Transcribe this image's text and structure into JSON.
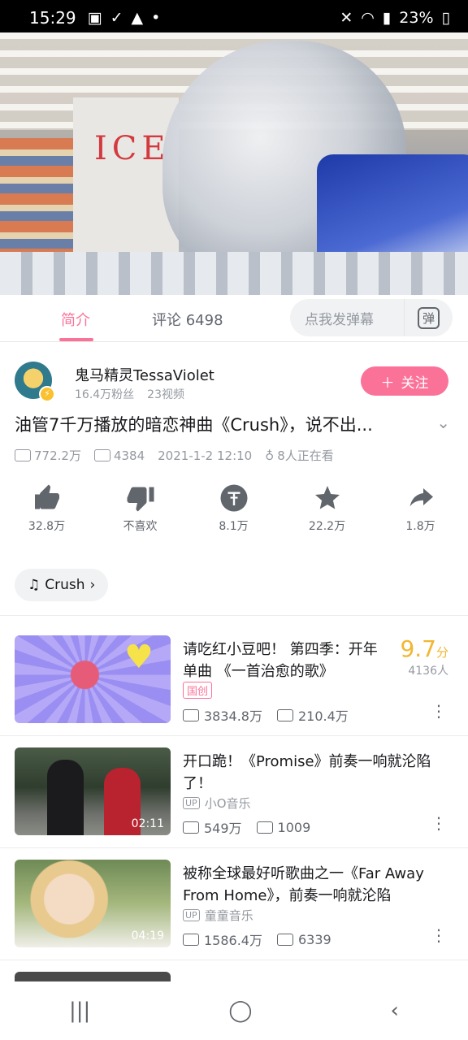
{
  "statusbar": {
    "time": "15:29",
    "battery": "23%"
  },
  "tabs": {
    "intro": "简介",
    "comments": "评论 6498"
  },
  "danmu": {
    "placeholder": "点我发弹幕",
    "button": "弹"
  },
  "uploader": {
    "name": "鬼马精灵TessaViolet",
    "fans": "16.4万粉丝",
    "videos": "23视频",
    "follow_label": "关注"
  },
  "video": {
    "title": "油管7千万播放的暗恋神曲《Crush》，说不出...",
    "views": "772.2万",
    "danmaku": "4384",
    "date": "2021-1-2 12:10",
    "watching": "8人正在看"
  },
  "actions": [
    {
      "icon": "thumbs-up-icon",
      "label": "32.8万"
    },
    {
      "icon": "thumbs-down-icon",
      "label": "不喜欢"
    },
    {
      "icon": "coin-icon",
      "label": "8.1万"
    },
    {
      "icon": "star-icon",
      "label": "22.2万"
    },
    {
      "icon": "share-icon",
      "label": "1.8万"
    }
  ],
  "music_tag": "Crush",
  "recommendations": [
    {
      "title": "请吃红小豆吧！ 第四季：开年单曲 《一首治愈的歌》",
      "score": "9.7",
      "score_unit": "分",
      "raters": "4136人",
      "tag": "国创",
      "views": "3834.8万",
      "danmaku": "210.4万"
    },
    {
      "title": "开口跪！《Promise》前奏一响就沦陷了！",
      "uploader": "小O音乐",
      "duration": "02:11",
      "views": "549万",
      "danmaku": "1009"
    },
    {
      "title": "被称全球最好听歌曲之一《Far Away From Home》，前奏一响就沦陷",
      "uploader": "童童音乐",
      "duration": "04:19",
      "views": "1586.4万",
      "danmaku": "6339"
    }
  ],
  "colors": {
    "accent": "#fb7299",
    "score": "#f2b632"
  }
}
